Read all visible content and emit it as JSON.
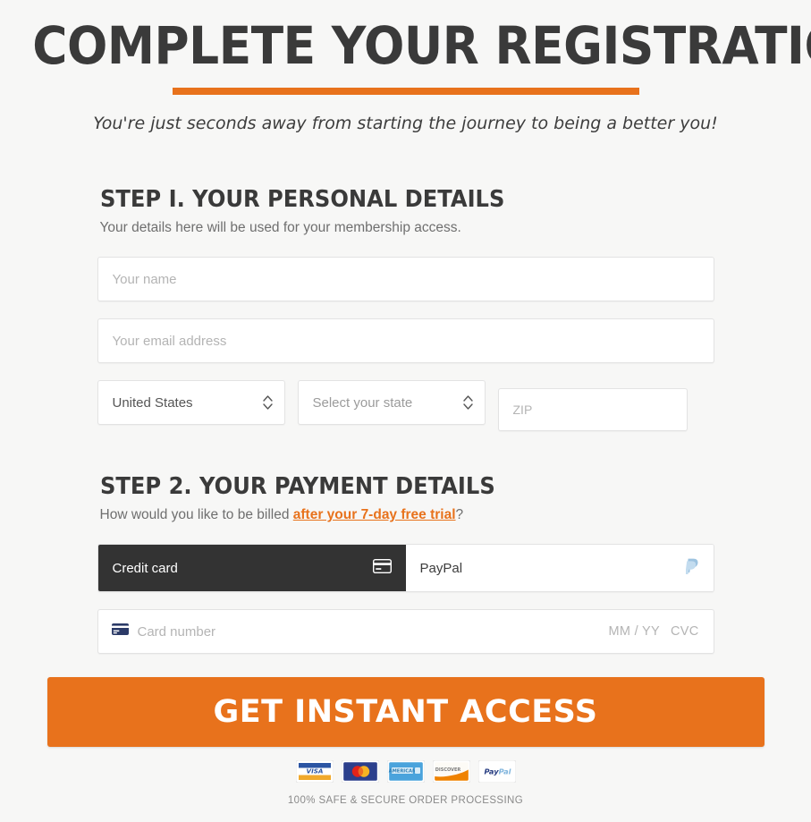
{
  "header": {
    "title": "COMPLETE YOUR REGISTRATION",
    "subtitle": "You're just seconds away from starting the journey to being a better you!",
    "accent_color": "#e8721c"
  },
  "step1": {
    "title": "STEP I. YOUR PERSONAL DETAILS",
    "description": "Your details here will be used for your membership access.",
    "name_placeholder": "Your name",
    "name_value": "",
    "email_placeholder": "Your email address",
    "email_value": "",
    "country_value": "United States",
    "state_value": "Select your state",
    "zip_placeholder": "ZIP",
    "zip_value": ""
  },
  "step2": {
    "title": "STEP 2. YOUR PAYMENT DETAILS",
    "description_prefix": "How would you like to be billed ",
    "description_link": "after your 7-day free trial",
    "description_suffix": "?",
    "tabs": [
      {
        "label": "Credit card",
        "icon": "credit-card-icon",
        "active": true
      },
      {
        "label": "PayPal",
        "icon": "paypal-icon",
        "active": false
      }
    ],
    "card_placeholder": "Card number",
    "card_value": "",
    "expiry_placeholder": "MM / YY",
    "cvc_placeholder": "CVC"
  },
  "cta": {
    "label": "GET INSTANT ACCESS",
    "color": "#e8721c"
  },
  "footer": {
    "badges": [
      {
        "name": "visa-badge",
        "label": "VISA"
      },
      {
        "name": "mastercard-badge",
        "label": "Mastercard"
      },
      {
        "name": "amex-badge",
        "label": "American Express"
      },
      {
        "name": "discover-badge",
        "label": "Discover"
      },
      {
        "name": "paypal-badge",
        "label": "PayPal"
      }
    ],
    "secure_text": "100% SAFE & SECURE ORDER PROCESSING"
  }
}
